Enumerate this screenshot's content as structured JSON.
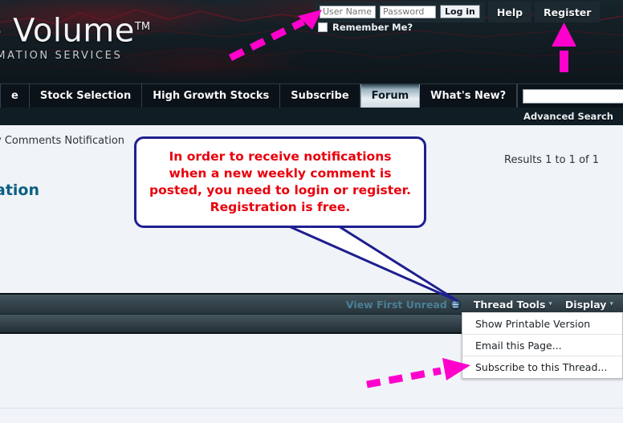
{
  "site": {
    "logo_main": "ive Volume",
    "logo_tm": "TM",
    "logo_sub": "INFORMATION SERVICES"
  },
  "login": {
    "username_placeholder": "User Name",
    "username_value": "",
    "password_placeholder": "Password",
    "password_value": "",
    "login_button": "Log in",
    "remember_label": "Remember Me?",
    "help_link": "Help",
    "register_link": "Register"
  },
  "nav": {
    "items": [
      {
        "label": "e",
        "active": false
      },
      {
        "label": "Stock Selection",
        "active": false
      },
      {
        "label": "High Growth Stocks",
        "active": false
      },
      {
        "label": "Subscribe",
        "active": false
      },
      {
        "label": "Forum",
        "active": true
      },
      {
        "label": "What's New?",
        "active": false
      }
    ],
    "search_value": "",
    "search_placeholder": "",
    "search_icon": "search-icon",
    "advanced_search": "Advanced Search"
  },
  "content": {
    "breadcrumb": "y Comments Notification",
    "page_heading": "ation",
    "results": "Results 1 to 1 of 1"
  },
  "toolsbar": {
    "view_first_unread": "View First Unread",
    "thread_tools": "Thread Tools",
    "display": "Display",
    "caret": "⌄"
  },
  "dropdown": {
    "items": [
      "Show Printable Version",
      "Email this Page...",
      "Subscribe to this Thread..."
    ]
  },
  "callout": {
    "text": "In order to receive notifications when a new weekly comment is posted, you need to login or register. Registration is free."
  },
  "colors": {
    "header_bg": "#141f25",
    "navbar_bg": "#0b1219",
    "content_bg": "#f0f3f7",
    "callout_border": "#1f1f8f",
    "callout_text": "#e8000c",
    "arrow_magenta": "#ff00cc",
    "heading_teal": "#0b5f84",
    "toolsbar_bg": "#38474f"
  }
}
